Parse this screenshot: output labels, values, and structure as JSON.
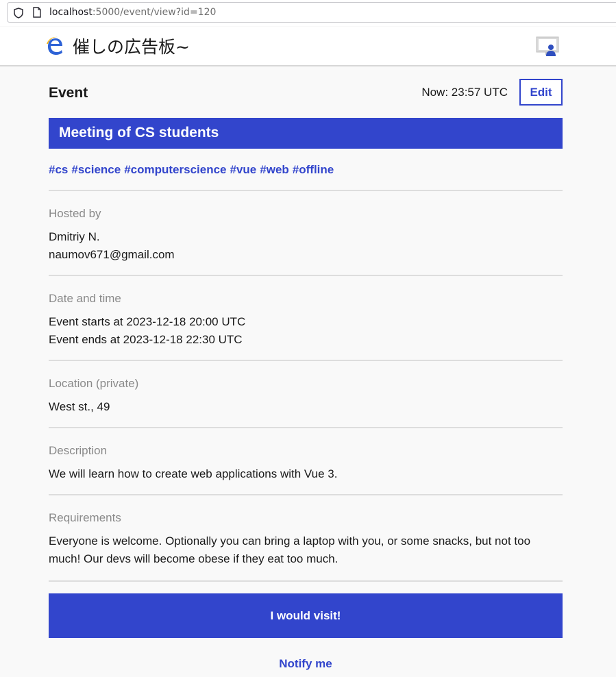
{
  "browser": {
    "url_host": "localhost",
    "url_rest": ":5000/event/view?id=120"
  },
  "header": {
    "site_title": "催しの広告板~"
  },
  "event": {
    "page_title": "Event",
    "now": "Now: 23:57 UTC",
    "edit_label": "Edit",
    "title": "Meeting of CS students",
    "tags": [
      "#cs",
      "#science",
      "#computerscience",
      "#vue",
      "#web",
      "#offline"
    ],
    "hosted_by": {
      "label": "Hosted by",
      "name": "Dmitriy N.",
      "email": "naumov671@gmail.com"
    },
    "date_time": {
      "label": "Date and time",
      "starts": "Event starts at 2023-12-18 20:00 UTC",
      "ends": "Event ends at 2023-12-18 22:30 UTC"
    },
    "location": {
      "label": "Location (private)",
      "value": "West st., 49"
    },
    "description": {
      "label": "Description",
      "value": "We will learn how to create web applications with Vue 3."
    },
    "requirements": {
      "label": "Requirements",
      "value": "Everyone is welcome. Optionally you can bring a laptop with you, or some snacks, but not too much! Our devs will become obese if they eat too much."
    },
    "visit_label": "I would visit!",
    "notify_label": "Notify me"
  },
  "colors": {
    "accent": "#3245cc",
    "background": "#f9f9f9",
    "label_gray": "#8a8a8a"
  },
  "icons": {
    "shield": "shield-icon",
    "page": "page-icon",
    "logo": "logo-icon",
    "account": "account-icon"
  }
}
